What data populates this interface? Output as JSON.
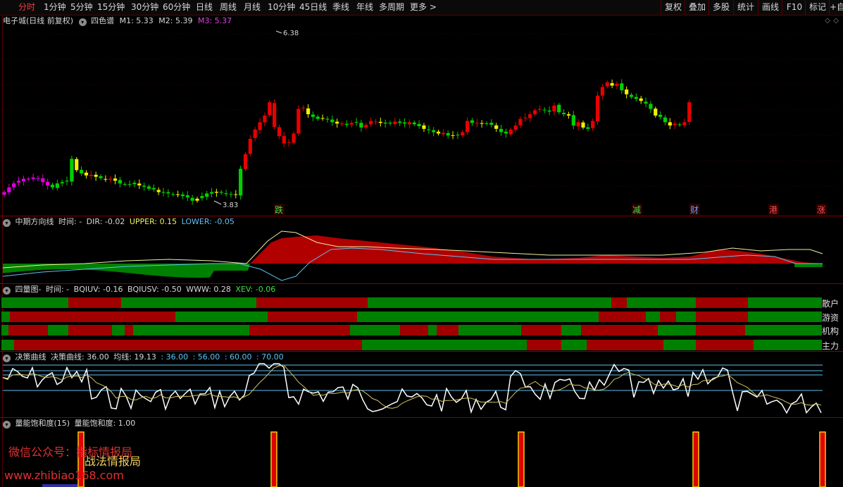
{
  "toolbar": {
    "periods": [
      "分时",
      "1分钟",
      "5分钟",
      "15分钟",
      "30分钟",
      "60分钟",
      "日线",
      "周线",
      "月线",
      "10分钟",
      "45日线",
      "季线",
      "年线",
      "多周期",
      "更多 >"
    ],
    "active_index": 0,
    "right_buttons": [
      "复权",
      "叠加",
      "多股",
      "统计",
      "画线",
      "F10",
      "标记",
      "+自"
    ]
  },
  "main_chart": {
    "stock": "电子城(日线 前复权)",
    "indicator": "四色谱",
    "m1": "M1: 5.33",
    "m2": "M2: 5.39",
    "m3": "M3: 5.37",
    "high_label": "6.38",
    "low_label": "3.83",
    "markers": [
      "跌",
      "减",
      "财",
      "港",
      "涨"
    ],
    "colors": {
      "up": "#e80000",
      "purple": "#e000e0",
      "green": "#00d000",
      "yellow": "#f0f000",
      "m3": "#e040e0"
    }
  },
  "chart_data": [
    {
      "type": "candlestick",
      "name_label": "四色谱",
      "x": [
        1,
        2,
        3,
        4,
        5,
        6,
        7,
        8,
        9,
        10,
        11,
        12,
        13,
        14,
        15,
        16,
        17,
        18,
        19,
        20,
        21,
        22,
        23,
        24,
        25,
        26,
        27,
        28,
        29,
        30,
        31,
        32,
        33,
        34,
        35,
        36,
        37,
        38,
        39,
        40,
        41,
        42,
        43,
        44,
        45,
        46,
        47,
        48,
        49,
        50,
        51,
        52,
        53,
        54,
        55,
        56,
        57,
        58,
        59,
        60,
        61,
        62,
        63,
        64,
        65,
        66,
        67,
        68,
        69,
        70,
        71,
        72,
        73,
        74,
        75,
        76,
        77,
        78,
        79,
        80,
        81,
        82,
        83,
        84,
        85,
        86,
        87,
        88,
        89,
        90,
        91,
        92,
        93,
        94,
        95,
        96,
        97,
        98,
        99,
        100,
        101,
        102,
        103,
        104,
        105,
        106,
        107,
        108,
        109,
        110,
        111,
        112,
        113,
        114,
        115,
        116,
        117,
        118,
        119,
        120,
        121,
        122,
        123,
        124,
        125,
        126,
        127,
        128,
        129,
        130,
        131,
        132,
        133,
        134,
        135,
        136,
        137,
        138,
        139,
        140,
        141,
        142,
        143,
        144,
        145,
        146,
        147,
        148,
        149,
        150,
        151,
        152,
        153,
        154,
        155,
        156,
        157,
        158,
        159,
        160,
        161,
        162,
        163,
        164,
        165,
        166,
        167,
        168,
        169,
        170
      ],
      "close": [
        4.05,
        4.12,
        4.18,
        4.22,
        4.25,
        4.24,
        4.27,
        4.26,
        4.2,
        4.15,
        4.12,
        4.18,
        4.2,
        4.22,
        4.55,
        4.38,
        4.33,
        4.3,
        4.31,
        4.28,
        4.26,
        4.24,
        4.25,
        4.22,
        4.18,
        4.17,
        4.16,
        4.19,
        4.15,
        4.13,
        4.1,
        4.09,
        4.05,
        4.04,
        4.03,
        4.02,
        4.01,
        3.99,
        3.97,
        3.92,
        3.95,
        3.99,
        4.03,
        4.05,
        4.04,
        4.04,
        4.02,
        4.01,
        4.01,
        4.4,
        4.62,
        4.85,
        4.99,
        5.1,
        5.2,
        5.4,
        5.03,
        4.89,
        4.78,
        4.8,
        4.93,
        5.3,
        5.32,
        5.22,
        5.18,
        5.15,
        5.16,
        5.14,
        5.1,
        5.08,
        5.08,
        5.06,
        5.09,
        5.1,
        5.02,
        5.06,
        5.12,
        5.11,
        5.09,
        5.08,
        5.08,
        5.11,
        5.09,
        5.08,
        5.1,
        5.07,
        5.04,
        5.0,
        4.98,
        4.95,
        4.93,
        4.94,
        4.9,
        4.9,
        4.91,
        4.95,
        5.12,
        5.09,
        5.09,
        5.08,
        5.08,
        5.06,
        5.0,
        4.95,
        4.93,
        4.99,
        5.05,
        5.15,
        5.17,
        5.22,
        5.28,
        5.3,
        5.28,
        5.26,
        5.35,
        5.25,
        5.22,
        5.2,
        5.05,
        5.1,
        5.02,
        5.0,
        5.12,
        5.5,
        5.63,
        5.7,
        5.65,
        5.68,
        5.58,
        5.52,
        5.48,
        5.45,
        5.42,
        5.38,
        5.3,
        5.2,
        5.18,
        5.1,
        5.05,
        5.08,
        5.06,
        5.1,
        5.4
      ]
    },
    {
      "type": "area",
      "name_label": "中期方向线",
      "series_labels": [
        "时间: -",
        "DIR: -0.02",
        "UPPER: 0.15",
        "LOWER: -0.05"
      ]
    },
    {
      "type": "heatmap",
      "name_label": "四量图-",
      "series_labels": [
        "时间: -",
        "BQIUV: -0.16",
        "BQIUSV: -0.50",
        "WWW: 0.28",
        "XEV: -0.06"
      ],
      "rows": [
        "散户",
        "游资",
        "机构",
        "主力"
      ]
    },
    {
      "type": "line",
      "name_label": "决策曲线",
      "series_labels": [
        "决策曲线: 36.00",
        "均线: 19.13",
        ": 36.00",
        ": 56.00",
        ": 60.00",
        ": 70.00"
      ]
    },
    {
      "type": "bar",
      "name_label": "量能饱和度(15)",
      "series_labels": [
        "量能饱和度: 1.00"
      ]
    }
  ],
  "panels": {
    "p2": {
      "title": "中期方向线",
      "labels": [
        "时间: -",
        "DIR: -0.02",
        "UPPER: 0.15",
        "LOWER: -0.05"
      ]
    },
    "p3": {
      "title": "四量图-",
      "labels": [
        "时间: -",
        "BQIUV: -0.16",
        "BQIUSV: -0.50",
        "WWW: 0.28",
        "XEV: -0.06"
      ],
      "rows": [
        "散户",
        "游资",
        "机构",
        "主力"
      ]
    },
    "p4": {
      "title": "决策曲线",
      "labels": [
        "决策曲线: 36.00",
        "均线: 19.13",
        ": 36.00",
        ": 56.00",
        ": 60.00",
        ": 70.00"
      ]
    },
    "p5": {
      "title": "量能饱和度(15)",
      "labels": [
        "量能饱和度: 1.00"
      ]
    }
  },
  "watermark": {
    "line1": "微信公众号：指标情报局",
    "line2": "战法情报局",
    "line3": "www.zhibiao168.com"
  }
}
